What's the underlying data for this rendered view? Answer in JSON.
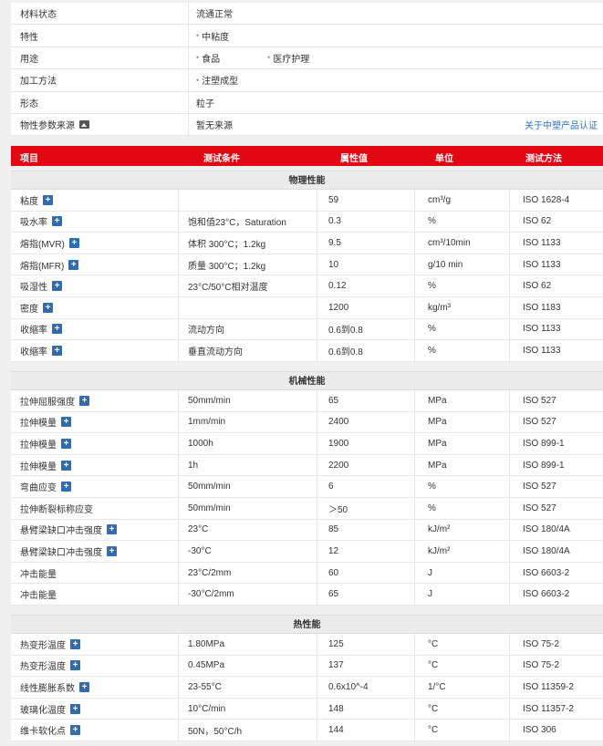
{
  "info": [
    {
      "label": "材料状态",
      "values": [
        "流通正常"
      ],
      "chips": false
    },
    {
      "label": "特性",
      "values": [
        "中粘度"
      ],
      "chips": true
    },
    {
      "label": "用途",
      "values": [
        "食品",
        "医疗护理"
      ],
      "chips": true
    },
    {
      "label": "加工方法",
      "values": [
        "注塑成型"
      ],
      "chips": true
    },
    {
      "label": "形态",
      "values": [
        "粒子"
      ],
      "chips": false
    },
    {
      "label": "物性参数来源",
      "values": [
        "暂无来源"
      ],
      "chips": false,
      "link": "关于中塑产品认证",
      "icon": "image-icon"
    }
  ],
  "headers": [
    "项目",
    "测试条件",
    "属性值",
    "单位",
    "测试方法"
  ],
  "sections": [
    {
      "title": "物理性能",
      "rows": [
        {
          "item": "粘度",
          "cond": "",
          "value": "59",
          "unit": "cm³/g",
          "method": "ISO 1628-4"
        },
        {
          "item": "吸水率",
          "cond": "饱和值23°C，Saturation",
          "value": "0.3",
          "unit": "%",
          "method": "ISO 62"
        },
        {
          "item": "熔指(MVR)",
          "cond": "体积 300°C；1.2kg",
          "value": "9.5",
          "unit": "cm³/10min",
          "method": "ISO 1133"
        },
        {
          "item": "熔指(MFR)",
          "cond": "质量 300°C；1.2kg",
          "value": "10",
          "unit": "g/10 min",
          "method": "ISO 1133"
        },
        {
          "item": "吸湿性",
          "cond": "23°C/50°C相对温度",
          "value": "0.12",
          "unit": "%",
          "method": "ISO 62"
        },
        {
          "item": "密度",
          "cond": "",
          "value": "1200",
          "unit": "kg/m³",
          "method": "ISO 1183"
        },
        {
          "item": "收缩率",
          "cond": "流动方向",
          "value": "0.6到0.8",
          "unit": "%",
          "method": "ISO 1133"
        },
        {
          "item": "收缩率",
          "cond": "垂直流动方向",
          "value": "0.6到0.8",
          "unit": "%",
          "method": "ISO 1133"
        }
      ]
    },
    {
      "title": "机械性能",
      "rows": [
        {
          "item": "拉伸屈服强度",
          "cond": "50mm/min",
          "value": "65",
          "unit": "MPa",
          "method": "ISO 527",
          "plus": true
        },
        {
          "item": "拉伸模量",
          "cond": "1mm/min",
          "value": "2400",
          "unit": "MPa",
          "method": "ISO 527",
          "plus": true
        },
        {
          "item": "拉伸模量",
          "cond": "1000h",
          "value": "1900",
          "unit": "MPa",
          "method": "ISO 899-1",
          "plus": true
        },
        {
          "item": "拉伸模量",
          "cond": "1h",
          "value": "2200",
          "unit": "MPa",
          "method": "ISO 899-1",
          "plus": true
        },
        {
          "item": "弯曲应变",
          "cond": "50mm/min",
          "value": "6",
          "unit": "%",
          "method": "ISO 527",
          "plus": true
        },
        {
          "item": "拉伸断裂标称应变",
          "cond": "50mm/min",
          "value": "＞50",
          "unit": "%",
          "method": "ISO 527",
          "plus": false
        },
        {
          "item": "悬臂梁缺口冲击强度",
          "cond": "23°C",
          "value": "85",
          "unit": "kJ/m²",
          "method": "ISO 180/4A",
          "plus": true
        },
        {
          "item": "悬臂梁缺口冲击强度",
          "cond": "-30°C",
          "value": "12",
          "unit": "kJ/m²",
          "method": "ISO 180/4A",
          "plus": true
        },
        {
          "item": "冲击能量",
          "cond": "23°C/2mm",
          "value": "60",
          "unit": "J",
          "method": "ISO 6603-2",
          "plus": false
        },
        {
          "item": "冲击能量",
          "cond": "-30°C/2mm",
          "value": "65",
          "unit": "J",
          "method": "ISO 6603-2",
          "plus": false
        }
      ]
    },
    {
      "title": "热性能",
      "rows": [
        {
          "item": "热变形温度",
          "cond": "1.80MPa",
          "value": "125",
          "unit": "°C",
          "method": "ISO 75-2",
          "plus": true
        },
        {
          "item": "热变形温度",
          "cond": "0.45MPa",
          "value": "137",
          "unit": "°C",
          "method": "ISO 75-2",
          "plus": true
        },
        {
          "item": "线性膨胀系数",
          "cond": "23-55°C",
          "value": "0.6x10^-4",
          "unit": "1/°C",
          "method": "ISO 11359-2",
          "plus": true
        },
        {
          "item": "玻璃化温度",
          "cond": "10°C/min",
          "value": "148",
          "unit": "°C",
          "method": "ISO 11357-2",
          "plus": true
        },
        {
          "item": "维卡软化点",
          "cond": "50N，50°C/h",
          "value": "144",
          "unit": "°C",
          "method": "ISO 306",
          "plus": true
        }
      ]
    }
  ],
  "colors": {
    "header_bg": "#e30613",
    "plus_icon": "#2e6db4",
    "link": "#2b6fc1"
  }
}
